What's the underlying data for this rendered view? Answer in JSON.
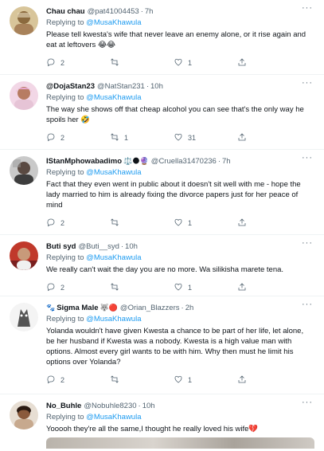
{
  "tweets": [
    {
      "name": "Chau chau",
      "handle": "@pat41004453",
      "time": "7h",
      "replying_prefix": "Replying to ",
      "replying_to": "@MusaKhawula",
      "text": "Please tell kwesta's wife that never leave an enemy alone, or it rise again and eat at leftovers 😂😂",
      "replies": "2",
      "retweets": "",
      "likes": "1"
    },
    {
      "name": "@DojaStan23",
      "handle": "@NatStan231",
      "time": "10h",
      "replying_prefix": "Replying to ",
      "replying_to": "@MusaKhawula",
      "text": "The way she shows off that cheap alcohol you can see that's the only way he spoils her 🤣",
      "replies": "2",
      "retweets": "1",
      "likes": "31"
    },
    {
      "name": "IStanMphowabadimo",
      "name_emoji": "⚖️🌑🔮",
      "handle": "@Cruella31470236",
      "time": "7h",
      "replying_prefix": "Replying to ",
      "replying_to": "@MusaKhawula",
      "text": "Fact that they even went in public about it doesn't sit well with me - hope the lady married to him is already fixing the divorce papers  just for her peace of mind",
      "replies": "2",
      "retweets": "",
      "likes": "1"
    },
    {
      "name": "Buti syd",
      "handle": "@Buti__syd",
      "time": "10h",
      "replying_prefix": "Replying to ",
      "replying_to": "@MusaKhawula",
      "text": "We really can't wait the day you are no more. Wa silikisha marete tena.",
      "replies": "2",
      "retweets": "",
      "likes": "1"
    },
    {
      "name_prefix_emoji": "🐾",
      "name": "Sigma Male",
      "name_emoji": "🐺🔴",
      "handle": "@Orian_Blazzers",
      "time": "2h",
      "replying_prefix": "Replying to ",
      "replying_to": "@MusaKhawula",
      "text": "Yolanda wouldn't have given Kwesta a chance to be part of her life, let alone, be her husband if Kwesta was a nobody. Kwesta is a high value man with options. Almost every girl wants to be with him. Why then must he limit his options over Yolanda?",
      "replies": "2",
      "retweets": "",
      "likes": "1"
    },
    {
      "name": "No_Buhle",
      "handle": "@Nobuhle8230",
      "time": "10h",
      "replying_prefix": "Replying to ",
      "replying_to": "@MusaKhawula",
      "text": "Yooooh they're all the same,I thought he really loved his wife💔"
    }
  ],
  "icons": {
    "reply": "reply-icon",
    "retweet": "retweet-icon",
    "like": "heart-icon",
    "share": "share-icon",
    "more": "more-icon"
  },
  "colors": {
    "link": "#1d9bf0",
    "secondary_text": "#536471",
    "divider": "#eff3f4"
  }
}
